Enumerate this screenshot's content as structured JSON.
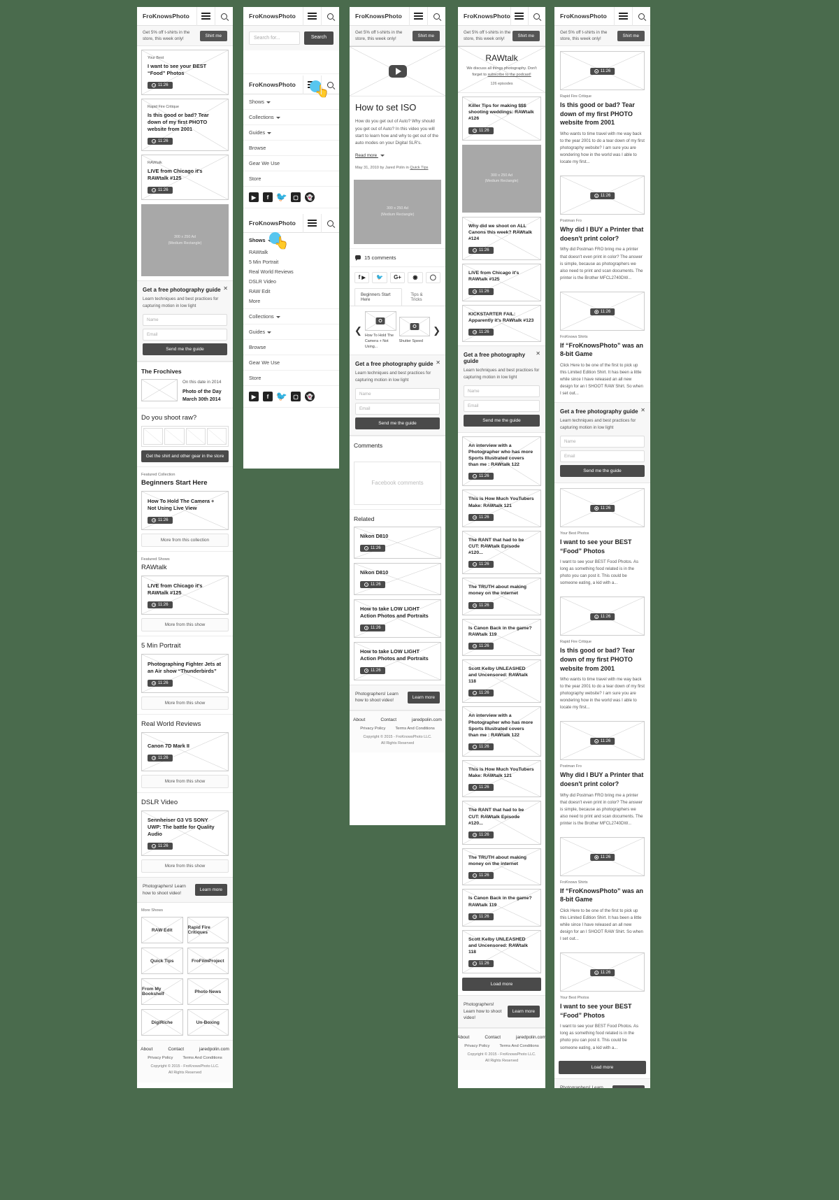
{
  "brand": {
    "name": "FroKnowsPhoto"
  },
  "promo": {
    "text": "Get 5% off t-shirts in the store, this week only!",
    "button": "Shirt me"
  },
  "icons": {
    "hamburger": "hamburger-icon",
    "search": "search-icon",
    "clock": "clock-icon",
    "play": "play-icon",
    "close": "close-icon"
  },
  "time_pill": "11:26",
  "ad": {
    "line1": "300 x 250 Ad",
    "line2": "(Medium Rectangle)"
  },
  "signup": {
    "title": "Get a free photography guide",
    "body": "Learn techniques and best practices for capturing motion in low light",
    "name_placeholder": "Name",
    "email_placeholder": "Email",
    "button": "Send me the guide"
  },
  "footer": {
    "links": [
      "About",
      "Contact",
      "jaredpolin.com"
    ],
    "legal": [
      "Privacy Policy",
      "Terms And Conditions"
    ],
    "copyright": "Copyright © 2015 - FroKnowsPhoto LLC.",
    "rights": "All Rights Reserved"
  },
  "learn_bar": {
    "text": "Photographers! Learn how to shoot video!",
    "button": "Learn more"
  },
  "screen1": {
    "feed": [
      {
        "kicker": "Your Best",
        "title": "I want to see your BEST “Food” Photos"
      },
      {
        "kicker": "Rapid Fire Critique",
        "title": "Is this good or bad? Tear down of my first PHOTO website from 2001"
      },
      {
        "kicker": "RAWtalk",
        "title": "LIVE from Chicago it's RAWtalk #125"
      }
    ],
    "frochives": {
      "heading": "The Frochives",
      "date_line": "On this date in 2014",
      "title": "Photo of the Day March 30th 2014"
    },
    "raw": {
      "heading": "Do you shoot raw?",
      "button": "Get the shirt and other gear in the store"
    },
    "collection": {
      "kicker": "Featured Collection",
      "heading": "Beginners Start Here",
      "item": "How To Hold The Camera + Not Using Live View",
      "more": "More from this collection"
    },
    "shows": [
      {
        "kicker": "Featured Shows",
        "heading": "RAWtalk",
        "item": "LIVE from Chicago it's RAWtalk #125",
        "more": "More from this show"
      },
      {
        "kicker": "",
        "heading": "5 Min Portrait",
        "item": "Photographing Fighter Jets at an Air show “Thunderbirds”",
        "more": "More from this show"
      },
      {
        "kicker": "",
        "heading": "Real World Reviews",
        "item": "Canon 7D Mark II",
        "more": "More from this show"
      },
      {
        "kicker": "",
        "heading": "DSLR Video",
        "item": "Sennheiser G3 VS SONY UWP: The battle for Quality Audio",
        "more": "More from this show"
      }
    ],
    "more_shows": {
      "heading": "More Shows",
      "cells": [
        "RAW Edit",
        "Rapid Fire Critiques",
        "Quick Tips",
        "FroFilmProject",
        "From My Bookshelf",
        "Photo News",
        "DigiRiche",
        "Un-Boxing"
      ]
    }
  },
  "screen2": {
    "search": {
      "placeholder": "Search for...",
      "button": "Search"
    },
    "menu": [
      "Shows",
      "Collections",
      "Guides",
      "Browse",
      "Gear We Use",
      "Store"
    ],
    "menu_caret": [
      true,
      true,
      true,
      false,
      false,
      false
    ],
    "social": [
      "youtube-icon",
      "facebook-icon",
      "twitter-icon",
      "instagram-icon",
      "snapchat-icon"
    ],
    "shows_submenu": [
      "RAWtalk",
      "5 Min Portrait",
      "Real World Reviews",
      "DSLR Video",
      "RAW Edit",
      "More"
    ]
  },
  "screen3": {
    "title": "How to set ISO",
    "body": "How do you get out of Auto?  Why should you get out of Auto? In this video you will start to learn how and why to get out of the auto modes on your Digital SLR's.",
    "read_more": "Read more",
    "meta_prefix": "May 31, 2010 by Jared Polin in ",
    "meta_link": "Quick Tips",
    "comments": "15 comments",
    "share_icons": [
      "facebook-icon",
      "youtube-icon",
      "twitter-icon",
      "google-plus-icon",
      "pinterest-icon",
      "more-icon"
    ],
    "tabs": [
      "Beginners Start Here",
      "Tips & Tricks"
    ],
    "carousel": [
      {
        "caption": "How To Hold The Camera + Not Using..."
      },
      {
        "caption": "Shutter Speed"
      }
    ],
    "comments_heading": "Comments",
    "fb_placeholder": "Facebook comments",
    "related_heading": "Related",
    "related": [
      "Nikon D810",
      "Nikon D810",
      "How to take LOW LIGHT Action Photos and Portraits",
      "How to take LOW LIGHT Action Photos and Portraits"
    ]
  },
  "screen4": {
    "show": {
      "title": "RAWtalk",
      "desc_line1": "We discuss all things photography. Don't",
      "desc_link": "subscribe to the podcast!",
      "desc_prefix": "forget to ",
      "count": "126 episodes"
    },
    "episodes_top": [
      "Killer Tips for making $$$ shooting weddings: RAWtalk #126"
    ],
    "episodes": [
      "Why did we shoot on ALL Canons this week? RAWtalk #124",
      "LIVE from Chicago it's RAWtalk #125",
      "KICKSTARTER FAIL: Apparently it's RAWtalk #123"
    ],
    "episodes2": [
      "An interview with a Photographer who has more Sports Illustrated covers than me : RAWtalk 122",
      "This is How Much YouTubers Make: RAWtalk 121",
      "The RANT that had to be CUT: RAWtalk Episode #120...",
      "The TRUTH about making money on the internet",
      "Is Canon Back in the game? RAWtalk 119",
      "Scott Kelby UNLEASHED and Uncensored: RAWtalk 118",
      "An interview with a Photographer who has more Sports Illustrated covers than me : RAWtalk 122",
      "This is How Much YouTubers Make: RAWtalk 121",
      "The RANT that had to be CUT: RAWtalk Episode #120...",
      "The TRUTH about making money on the internet",
      "Is Canon Back in the game? RAWtalk 119",
      "Scott Kelby UNLEASHED and Uncensored: RAWtalk 118"
    ],
    "load_more": "Load more"
  },
  "screen5": {
    "posts": [
      {
        "kicker": "Rapid Fire Critique",
        "title": "Is this good or bad? Tear down of my first PHOTO website from 2001",
        "excerpt": "Who wants to time travel with me way back to the year 2001 to do a tear down of my first photography website? I am sure you are wondering how in the world was I able to locate my first..."
      },
      {
        "kicker": "Postman Fro",
        "title": "Why did I BUY a Printer that doesn't print color?",
        "excerpt": "Why did Postman FRO bring me a printer that doesn't even print in color? The answer is simple, because as photographers we also need to print and scan documents. The printer is the Brother MFCL2740DW..."
      },
      {
        "kicker": "FroKnows Shirts",
        "title": "If “FroKnowsPhoto” was an 8-bit Game",
        "excerpt": "Click Here to be one of the first to pick up this Limited Edition Shirt. It has been a little while since I have released an all new design for an I SHOOT RAW Shirt. So when I set out..."
      },
      {
        "kicker": "Your Best Photos",
        "title": "I want to see your BEST “Food” Photos",
        "excerpt": "I want to see your BEST Food Photos. As long as something food related is in the photo you can post it. This could be someone eating, a kid with a..."
      },
      {
        "kicker": "Rapid Fire Critique",
        "title": "Is this good or bad? Tear down of my first PHOTO website from 2001",
        "excerpt": "Who wants to time travel with me way back to the year 2001 to do a tear down of my first photography website? I am sure you are wondering how in the world was I able to locate my first..."
      },
      {
        "kicker": "Postman Fro",
        "title": "Why did I BUY a Printer that doesn't print color?",
        "excerpt": "Why did Postman FRO bring me a printer that doesn't even print in color? The answer is simple, because as photographers we also need to print and scan documents. The printer is the Brother MFCL2740DW..."
      },
      {
        "kicker": "FroKnows Shirts",
        "title": "If “FroKnowsPhoto” was an 8-bit Game",
        "excerpt": "Click Here to be one of the first to pick up this Limited Edition Shirt. It has been a little while since I have released an all new design for an I SHOOT RAW Shirt. So when I set out..."
      },
      {
        "kicker": "Your Best Photos",
        "title": "I want to see your BEST “Food” Photos",
        "excerpt": "I want to see your BEST Food Photos. As long as something food related is in the photo you can post it. This could be someone eating, a kid with a..."
      }
    ],
    "load_more": "Load more"
  }
}
